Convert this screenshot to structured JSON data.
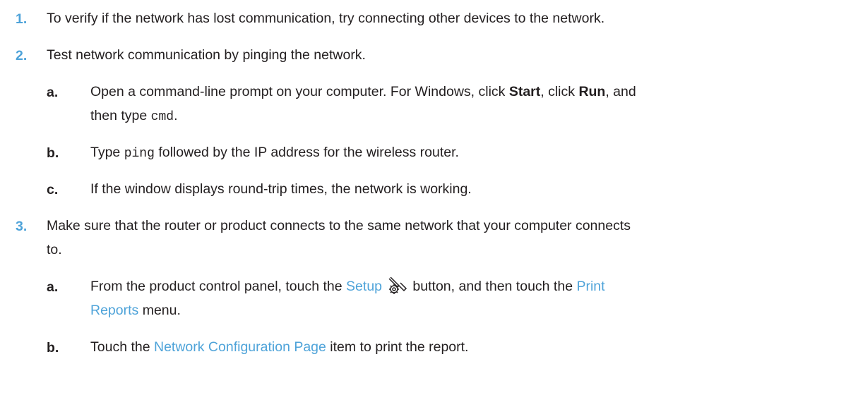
{
  "steps": [
    {
      "number": "1.",
      "text": "To verify if the network has lost communication, try connecting other devices to the network."
    },
    {
      "number": "2.",
      "text": "Test network communication by pinging the network.",
      "substeps": [
        {
          "letter": "a.",
          "t1": "Open a command-line prompt on your computer. For Windows, click ",
          "b1": "Start",
          "t2": ", click ",
          "b2": "Run",
          "t3": ", and",
          "line2_prefix": "then type ",
          "code": "cmd",
          "line2_suffix": "."
        },
        {
          "letter": "b.",
          "prefix": "Type ",
          "code": "ping",
          "suffix": " followed by the IP address for the wireless router."
        },
        {
          "letter": "c.",
          "text": "If the window displays round-trip times, the network is working."
        }
      ]
    },
    {
      "number": "3.",
      "line1": "Make sure that the router or product connects to the same network that your computer connects",
      "line2": "to.",
      "substeps": [
        {
          "letter": "a.",
          "t1": "From the product control panel, touch the ",
          "ui1": "Setup",
          "icon": "setup-wrench-gear-icon",
          "t2": " button, and then touch the ",
          "ui2a": "Print",
          "ui2b": "Reports",
          "t3": " menu."
        },
        {
          "letter": "b.",
          "t1": "Touch the ",
          "ui1": "Network Configuration Page",
          "t2": " item to print the report."
        }
      ]
    }
  ],
  "colors": {
    "step_number": "#4ea3d9",
    "ui_term": "#4ea3d9",
    "body_text": "#231f20"
  }
}
